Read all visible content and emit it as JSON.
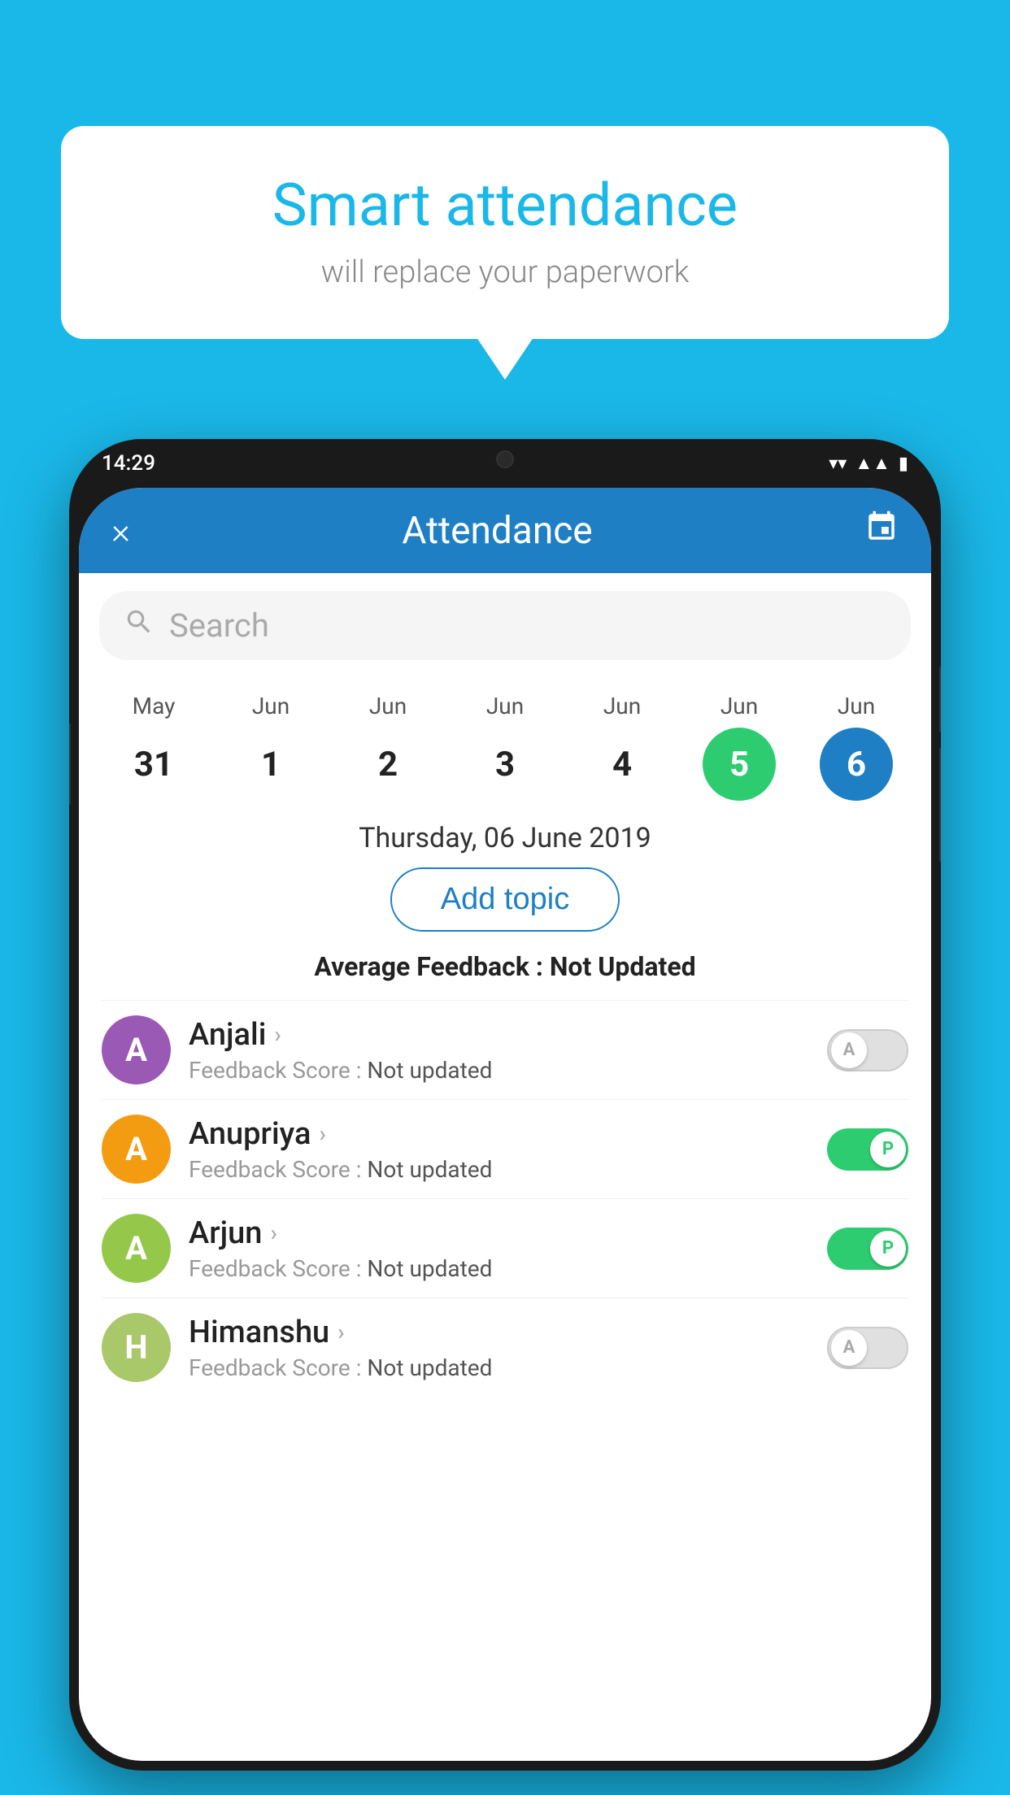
{
  "background_color": "#1ab8e8",
  "speech_bubble": {
    "title": "Smart attendance",
    "subtitle": "will replace your paperwork"
  },
  "phone": {
    "status_bar": {
      "time": "14:29",
      "icons": [
        "wifi",
        "signal",
        "battery"
      ]
    },
    "header": {
      "title": "Attendance",
      "close_icon": "×",
      "calendar_icon": "📅"
    },
    "search": {
      "placeholder": "Search"
    },
    "calendar": {
      "columns": [
        {
          "month": "May",
          "day": "31",
          "style": "normal"
        },
        {
          "month": "Jun",
          "day": "1",
          "style": "normal"
        },
        {
          "month": "Jun",
          "day": "2",
          "style": "normal"
        },
        {
          "month": "Jun",
          "day": "3",
          "style": "normal"
        },
        {
          "month": "Jun",
          "day": "4",
          "style": "normal"
        },
        {
          "month": "Jun",
          "day": "5",
          "style": "today"
        },
        {
          "month": "Jun",
          "day": "6",
          "style": "selected"
        }
      ]
    },
    "selected_date": "Thursday, 06 June 2019",
    "add_topic_label": "Add topic",
    "avg_feedback_label": "Average Feedback : ",
    "avg_feedback_value": "Not Updated",
    "students": [
      {
        "name": "Anjali",
        "avatar_letter": "A",
        "avatar_color": "#9b59b6",
        "feedback_label": "Feedback Score : ",
        "feedback_value": "Not updated",
        "toggle_state": "off",
        "toggle_letter": "A"
      },
      {
        "name": "Anupriya",
        "avatar_letter": "A",
        "avatar_color": "#f39c12",
        "feedback_label": "Feedback Score : ",
        "feedback_value": "Not updated",
        "toggle_state": "on",
        "toggle_letter": "P"
      },
      {
        "name": "Arjun",
        "avatar_letter": "A",
        "avatar_color": "#95c84a",
        "feedback_label": "Feedback Score : ",
        "feedback_value": "Not updated",
        "toggle_state": "on",
        "toggle_letter": "P"
      },
      {
        "name": "Himanshu",
        "avatar_letter": "H",
        "avatar_color": "#a8c86a",
        "feedback_label": "Feedback Score : ",
        "feedback_value": "Not updated",
        "toggle_state": "off",
        "toggle_letter": "A"
      }
    ]
  }
}
